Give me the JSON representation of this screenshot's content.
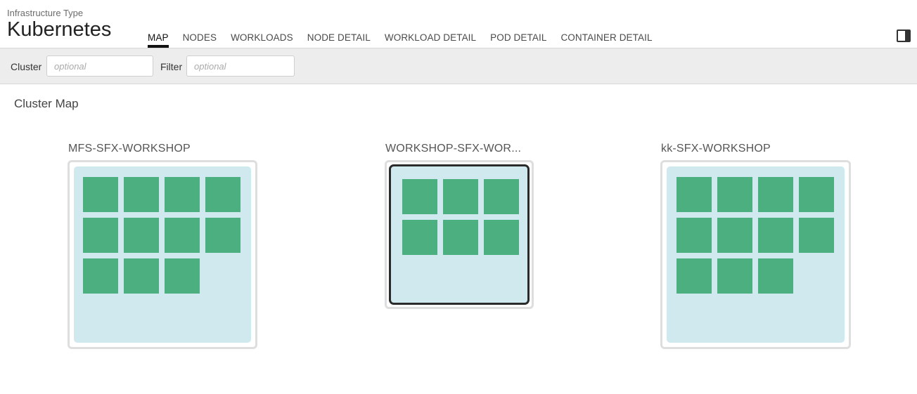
{
  "header": {
    "subtitle": "Infrastructure Type",
    "title": "Kubernetes",
    "tabs": [
      {
        "label": "MAP",
        "active": true
      },
      {
        "label": "NODES",
        "active": false
      },
      {
        "label": "WORKLOADS",
        "active": false
      },
      {
        "label": "NODE DETAIL",
        "active": false
      },
      {
        "label": "WORKLOAD DETAIL",
        "active": false
      },
      {
        "label": "POD DETAIL",
        "active": false
      },
      {
        "label": "CONTAINER DETAIL",
        "active": false
      }
    ],
    "panel_toggle_icon": "sidebar-panel-icon"
  },
  "filters": {
    "cluster_label": "Cluster",
    "cluster_placeholder": "optional",
    "filter_label": "Filter",
    "filter_placeholder": "optional"
  },
  "map": {
    "section_title": "Cluster Map",
    "clusters": [
      {
        "name": "MFS-SFX-WORKSHOP",
        "node_count": 11,
        "selected": false
      },
      {
        "name": "WORKSHOP-SFX-WOR...",
        "node_count": 6,
        "selected": true
      },
      {
        "name": "kk-SFX-WORKSHOP",
        "node_count": 11,
        "selected": false
      }
    ]
  },
  "colors": {
    "node_fill": "#4caf80",
    "cluster_bg": "#d0e9ef",
    "selected_border": "#2b2b2b"
  }
}
